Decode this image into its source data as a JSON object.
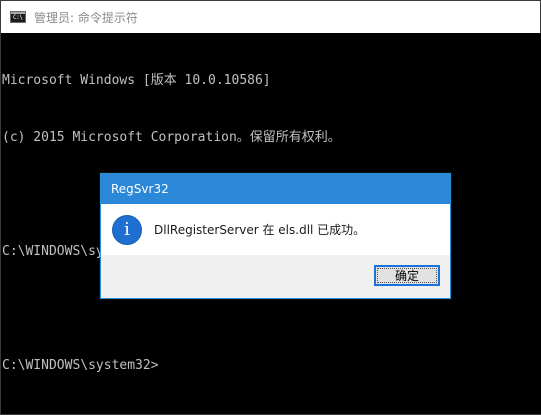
{
  "window": {
    "title": "管理员: 命令提示符",
    "icon": "cmd-icon",
    "icon_glyph": "C:\\"
  },
  "console": {
    "lines": [
      "Microsoft Windows [版本 10.0.10586]",
      "(c) 2015 Microsoft Corporation。保留所有权利。",
      "",
      "C:\\WINDOWS\\system32>regsvr32 els.dll",
      "",
      "C:\\WINDOWS\\system32>"
    ]
  },
  "dialog": {
    "title": "RegSvr32",
    "icon": "info-icon",
    "icon_glyph": "i",
    "message": "DllRegisterServer 在 els.dll 已成功。",
    "ok_label": "确定"
  },
  "colors": {
    "console_bg": "#000000",
    "console_text": "#c0c0c0",
    "dialog_title_bg": "#2b88d8",
    "info_icon": "#1e6fd0",
    "button_focus_border": "#1a73d9"
  }
}
